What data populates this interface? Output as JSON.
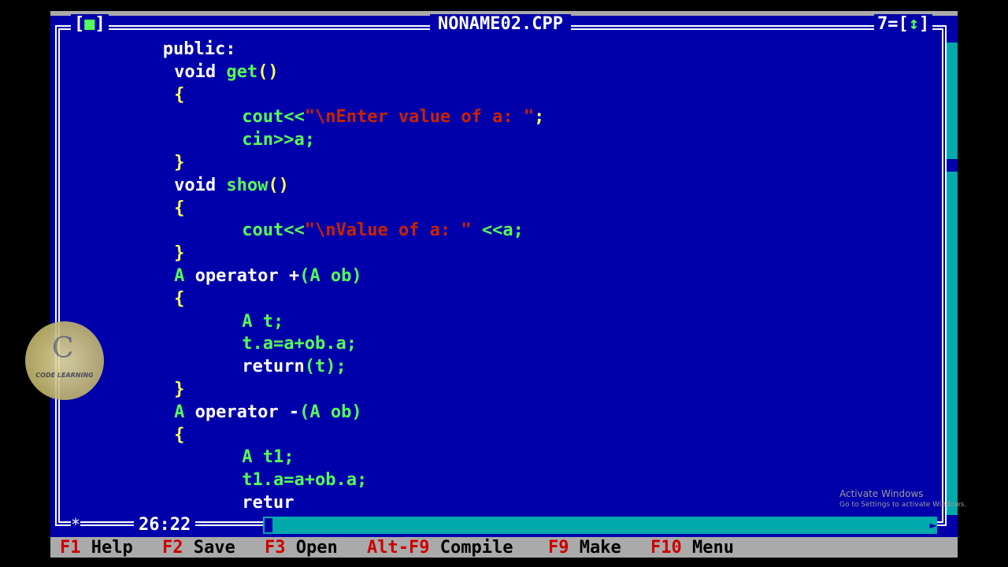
{
  "editor": {
    "close_box_left": "[",
    "close_box_mark": "■",
    "close_box_right": "]",
    "filename": "NONAME02.CPP",
    "window_number": "7=[",
    "zoom_mark": "↕",
    "window_number_end": "]",
    "cursor_position": "26:22",
    "star": "*"
  },
  "code_lines": [
    {
      "indent": "        ",
      "tokens": [
        {
          "t": "public:",
          "c": "w"
        }
      ]
    },
    {
      "indent": "         ",
      "tokens": [
        {
          "t": "void ",
          "c": "w"
        },
        {
          "t": "get",
          "c": "g"
        },
        {
          "t": "()",
          "c": "y"
        }
      ]
    },
    {
      "indent": "         ",
      "tokens": [
        {
          "t": "{",
          "c": "y"
        }
      ]
    },
    {
      "indent": "               ",
      "tokens": [
        {
          "t": "cout<<",
          "c": "g"
        },
        {
          "t": "\"\\nEnter value of a: \"",
          "c": "r"
        },
        {
          "t": ";",
          "c": "y"
        }
      ]
    },
    {
      "indent": "               ",
      "tokens": [
        {
          "t": "cin>>a;",
          "c": "g"
        }
      ]
    },
    {
      "indent": "         ",
      "tokens": [
        {
          "t": "}",
          "c": "y"
        }
      ]
    },
    {
      "indent": "         ",
      "tokens": [
        {
          "t": "void ",
          "c": "w"
        },
        {
          "t": "show",
          "c": "g"
        },
        {
          "t": "()",
          "c": "y"
        }
      ]
    },
    {
      "indent": "         ",
      "tokens": [
        {
          "t": "{",
          "c": "y"
        }
      ]
    },
    {
      "indent": "               ",
      "tokens": [
        {
          "t": "cout<<",
          "c": "g"
        },
        {
          "t": "\"\\nValue of a: \"",
          "c": "r"
        },
        {
          "t": " <<a;",
          "c": "g"
        }
      ]
    },
    {
      "indent": "         ",
      "tokens": [
        {
          "t": "}",
          "c": "y"
        }
      ]
    },
    {
      "indent": "         ",
      "tokens": [
        {
          "t": "A ",
          "c": "g"
        },
        {
          "t": "operator +",
          "c": "w"
        },
        {
          "t": "(A ob)",
          "c": "g"
        }
      ]
    },
    {
      "indent": "         ",
      "tokens": [
        {
          "t": "{",
          "c": "y"
        }
      ]
    },
    {
      "indent": "               ",
      "tokens": [
        {
          "t": "A t;",
          "c": "g"
        }
      ]
    },
    {
      "indent": "               ",
      "tokens": [
        {
          "t": "t.a=a+ob.a;",
          "c": "g"
        }
      ]
    },
    {
      "indent": "               ",
      "tokens": [
        {
          "t": "return",
          "c": "w"
        },
        {
          "t": "(t);",
          "c": "g"
        }
      ]
    },
    {
      "indent": "         ",
      "tokens": [
        {
          "t": "}",
          "c": "y"
        }
      ]
    },
    {
      "indent": "         ",
      "tokens": [
        {
          "t": "A ",
          "c": "g"
        },
        {
          "t": "operator -",
          "c": "w"
        },
        {
          "t": "(A ob)",
          "c": "g"
        }
      ]
    },
    {
      "indent": "         ",
      "tokens": [
        {
          "t": "{",
          "c": "y"
        }
      ]
    },
    {
      "indent": "               ",
      "tokens": [
        {
          "t": "A t1;",
          "c": "g"
        }
      ]
    },
    {
      "indent": "               ",
      "tokens": [
        {
          "t": "t1.a=a+ob.a;",
          "c": "g"
        }
      ]
    },
    {
      "indent": "               ",
      "tokens": [
        {
          "t": "retur",
          "c": "w"
        }
      ]
    }
  ],
  "menu": [
    {
      "key": "F1",
      "label": "Help"
    },
    {
      "key": "F2",
      "label": "Save"
    },
    {
      "key": "F3",
      "label": "Open"
    },
    {
      "key": "Alt-F9",
      "label": "Compile"
    },
    {
      "key": "F9",
      "label": "Make"
    },
    {
      "key": "F10",
      "label": "Menu"
    }
  ],
  "watermark": {
    "line1": "Activate Windows",
    "line2": "Go to Settings to activate Windows."
  },
  "logo": {
    "letter": "C",
    "text": "CODE LEARNING"
  },
  "colors": {
    "background": "#0000AA",
    "keyword_white": "#ffffff",
    "identifier_green": "#55ff55",
    "brace_yellow": "#ffff55",
    "string_red": "#cc2200",
    "menubar": "#aaaaaa",
    "scroll": "#00AAAA"
  }
}
